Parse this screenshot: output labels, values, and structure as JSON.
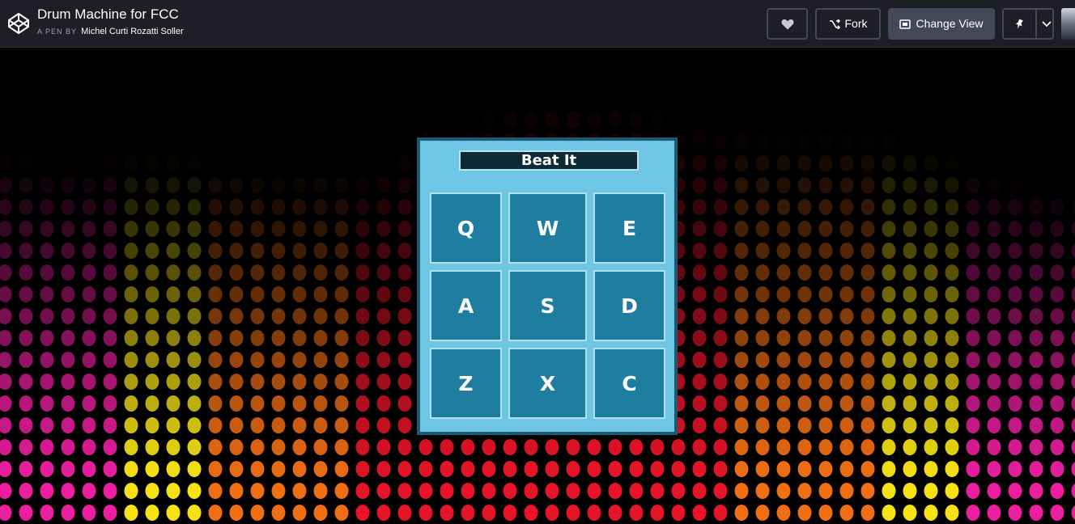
{
  "header": {
    "pen_title": "Drum Machine for FCC",
    "byline_prefix": "A PEN BY",
    "author": "Michel Curti Rozatti Soller",
    "buttons": {
      "heart_icon": "heart-icon",
      "fork_label": "Fork",
      "change_view_label": "Change View",
      "pin_icon": "pin-icon"
    }
  },
  "drum_machine": {
    "display": "Beat It",
    "pads": [
      "Q",
      "W",
      "E",
      "A",
      "S",
      "D",
      "Z",
      "X",
      "C"
    ]
  },
  "colors": {
    "header_bg": "#1e1f26",
    "machine_bg": "#6ec6e4",
    "pad_bg": "#1f7ea0",
    "display_bg": "#0d2a36"
  }
}
